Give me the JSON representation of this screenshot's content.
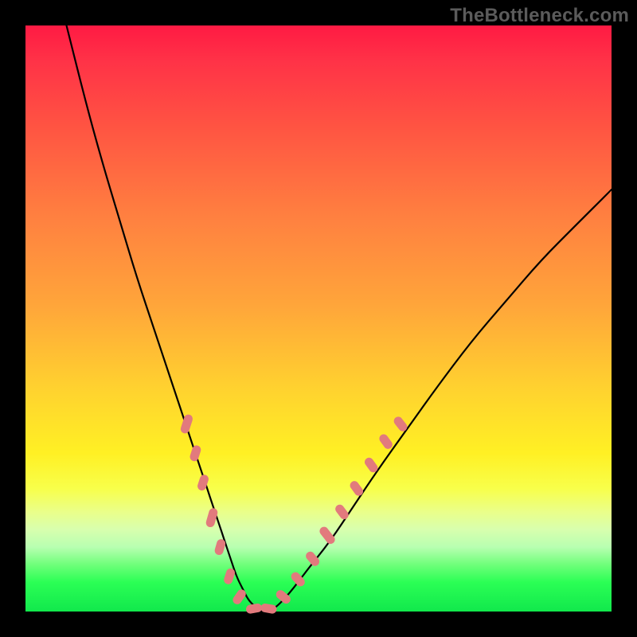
{
  "watermark": "TheBottleneck.com",
  "colors": {
    "frame": "#000000",
    "curve": "#000000",
    "marker": "#e27a7d",
    "gradient_top": "#ff1a43",
    "gradient_bottom": "#11e84c"
  },
  "chart_data": {
    "type": "line",
    "title": "",
    "xlabel": "",
    "ylabel": "",
    "xlim": [
      0,
      100
    ],
    "ylim": [
      0,
      100
    ],
    "grid": false,
    "legend": false,
    "series": [
      {
        "name": "curve",
        "x": [
          7,
          10,
          13,
          16,
          19,
          22,
          24,
          26,
          28,
          30,
          31,
          32,
          33,
          34,
          35,
          36,
          37,
          38,
          39,
          40,
          42,
          45,
          48,
          52,
          56,
          60,
          65,
          70,
          76,
          82,
          88,
          94,
          100
        ],
        "y": [
          100,
          88,
          77,
          67,
          57,
          48,
          42,
          36,
          30,
          24,
          21,
          18,
          15,
          12,
          9,
          6,
          4,
          2,
          1,
          0,
          0,
          3,
          7,
          12,
          18,
          24,
          31,
          38,
          46,
          53,
          60,
          66,
          72
        ]
      }
    ],
    "markers": [
      {
        "x": 27.5,
        "y": 32,
        "len": 6,
        "angle": -72
      },
      {
        "x": 29.0,
        "y": 27,
        "len": 5,
        "angle": -72
      },
      {
        "x": 30.3,
        "y": 22,
        "len": 5,
        "angle": -72
      },
      {
        "x": 31.8,
        "y": 16,
        "len": 6,
        "angle": -74
      },
      {
        "x": 33.2,
        "y": 11,
        "len": 5,
        "angle": -74
      },
      {
        "x": 34.8,
        "y": 6,
        "len": 5,
        "angle": -72
      },
      {
        "x": 36.5,
        "y": 2.5,
        "len": 5,
        "angle": -55
      },
      {
        "x": 39.0,
        "y": 0.5,
        "len": 5,
        "angle": -10
      },
      {
        "x": 41.5,
        "y": 0.5,
        "len": 5,
        "angle": 10
      },
      {
        "x": 44.0,
        "y": 2.5,
        "len": 5,
        "angle": 40
      },
      {
        "x": 46.5,
        "y": 5.5,
        "len": 5,
        "angle": 48
      },
      {
        "x": 49.0,
        "y": 9,
        "len": 5,
        "angle": 50
      },
      {
        "x": 51.5,
        "y": 13,
        "len": 6,
        "angle": 52
      },
      {
        "x": 54.0,
        "y": 17,
        "len": 5,
        "angle": 53
      },
      {
        "x": 56.5,
        "y": 21,
        "len": 5,
        "angle": 54
      },
      {
        "x": 59.0,
        "y": 25,
        "len": 5,
        "angle": 54
      },
      {
        "x": 61.5,
        "y": 29,
        "len": 5,
        "angle": 54
      },
      {
        "x": 64.0,
        "y": 32,
        "len": 5,
        "angle": 52
      }
    ]
  }
}
